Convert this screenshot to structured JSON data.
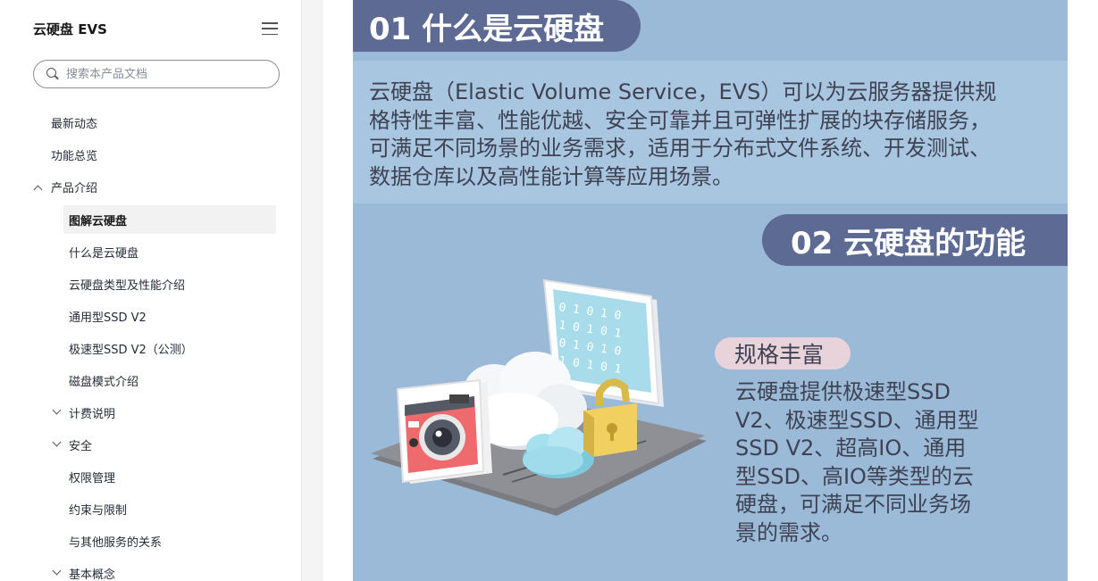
{
  "sidebar": {
    "title": "云硬盘 EVS",
    "search_placeholder": "搜索本产品文档",
    "items": [
      {
        "label": "最新动态"
      },
      {
        "label": "功能总览"
      },
      {
        "label": "产品介绍"
      },
      {
        "label": "图解云硬盘"
      },
      {
        "label": "什么是云硬盘"
      },
      {
        "label": "云硬盘类型及性能介绍"
      },
      {
        "label": "通用型SSD V2"
      },
      {
        "label": "极速型SSD V2（公测）"
      },
      {
        "label": "磁盘模式介绍"
      },
      {
        "label": "计费说明"
      },
      {
        "label": "安全"
      },
      {
        "label": "权限管理"
      },
      {
        "label": "约束与限制"
      },
      {
        "label": "与其他服务的关系"
      },
      {
        "label": "基本概念"
      }
    ]
  },
  "infographic": {
    "section1_title": "01 什么是云硬盘",
    "intro_lines": [
      "云硬盘（Elastic Volume Service，EVS）可以为云服务器提供规",
      "格特性丰富、性能优越、安全可靠并且可弹性扩展的块存储服务，",
      "可满足不同场景的业务需求，适用于分布式文件系统、开发测试、",
      "数据仓库以及高性能计算等应用场景。"
    ],
    "section2_title": "02 云硬盘的功能",
    "feature_label": "规格丰富",
    "feature_lines": [
      "云硬盘提供极速型SSD",
      "V2、极速型SSD、通用型",
      "SSD V2、超高IO、通用",
      "型SSD、高IO等类型的云",
      "硬盘，可满足不同业务场",
      "景的需求。"
    ],
    "binary_rows": [
      "0 1 0 1 0",
      "1 0 1 0 1",
      "0 1 0 1 0",
      "1 0 1 0 1"
    ]
  },
  "colors": {
    "header_bg": "#5d6a94",
    "infographic_bg": "#9bbad7",
    "band_bg": "#a8c6df",
    "pill_bg": "#e8d3db",
    "text_dark": "#3f4253"
  }
}
